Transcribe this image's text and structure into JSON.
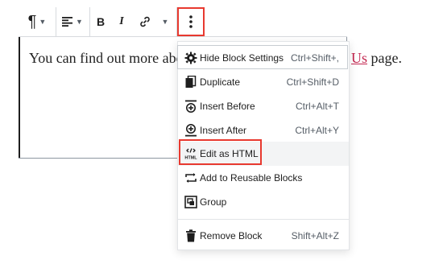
{
  "toolbar": {
    "paragraph_icon": "pilcrow-icon",
    "align_icon": "align-left-icon",
    "bold_label": "B",
    "italic_label": "I",
    "link_icon": "link-icon",
    "more_icon": "vertical-ellipsis-icon"
  },
  "paragraph": {
    "text_start": "You can find out more abo",
    "link_text": "Us",
    "text_end": " page."
  },
  "menu": {
    "items": [
      {
        "label": "Hide Block Settings",
        "shortcut": "Ctrl+Shift+,",
        "icon": "gear-icon"
      },
      {
        "label": "Duplicate",
        "shortcut": "Ctrl+Shift+D",
        "icon": "duplicate-icon"
      },
      {
        "label": "Insert Before",
        "shortcut": "Ctrl+Alt+T",
        "icon": "insert-before-icon"
      },
      {
        "label": "Insert After",
        "shortcut": "Ctrl+Alt+Y",
        "icon": "insert-after-icon"
      },
      {
        "label": "Edit as HTML",
        "shortcut": "",
        "icon": "html-icon"
      },
      {
        "label": "Add to Reusable Blocks",
        "shortcut": "",
        "icon": "reusable-blocks-icon"
      },
      {
        "label": "Group",
        "shortcut": "",
        "icon": "group-icon"
      },
      {
        "label": "Remove Block",
        "shortcut": "Shift+Alt+Z",
        "icon": "trash-icon"
      }
    ]
  },
  "colors": {
    "highlight": "#e8392f",
    "link": "#c3254e"
  }
}
